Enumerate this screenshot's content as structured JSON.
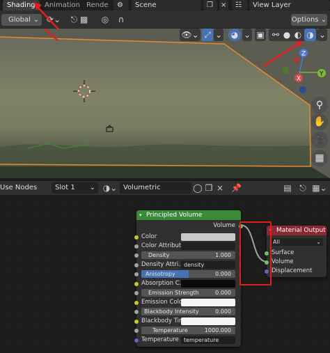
{
  "workspace": {
    "tabs": [
      "Shading",
      "Animation",
      "Rende"
    ],
    "active_tab": "Shading",
    "scene_label": "Scene",
    "view_layer_label": "View Layer"
  },
  "viewport_header": {
    "view_mode": "Global",
    "options_label": "Options"
  },
  "navigation_gizmo": {
    "axes": [
      "X",
      "Y",
      "Z"
    ]
  },
  "node_editor_header": {
    "use_nodes_label": "Use Nodes",
    "slot_label": "Slot 1",
    "material_name": "Volumetric"
  },
  "principled_volume": {
    "title": "Principled Volume",
    "output_label": "Volume",
    "color_label": "Color",
    "color_attribute_label": "Color Attribute",
    "density_label": "Density",
    "density_value": "1.000",
    "density_attribute_label": "Density Attri...",
    "density_attribute_value": "density",
    "anisotropy_label": "Anisotropy",
    "anisotropy_value": "0.000",
    "absorption_color_label": "Absorption C...",
    "emission_strength_label": "Emission Strength",
    "emission_strength_value": "0.000",
    "emission_color_label": "Emission Color",
    "blackbody_intensity_label": "Blackbody Intensity",
    "blackbody_intensity_value": "0.000",
    "blackbody_tint_label": "Blackbody Tin",
    "temperature_label": "Temperature",
    "temperature_value": "1000.000",
    "temperature_attribute_label": "Temperature ...",
    "temperature_attribute_value": "temperature"
  },
  "material_output": {
    "title": "Material Output",
    "target": "All",
    "inputs": [
      "Surface",
      "Volume",
      "Displacement"
    ]
  },
  "colors": {
    "volume_node_header": "#3a8a3a",
    "output_node_header": "#8c2834",
    "annotation_red": "#e01e1e",
    "selection_orange": "#e68a2e",
    "viewport_bg": "#5d6051"
  }
}
